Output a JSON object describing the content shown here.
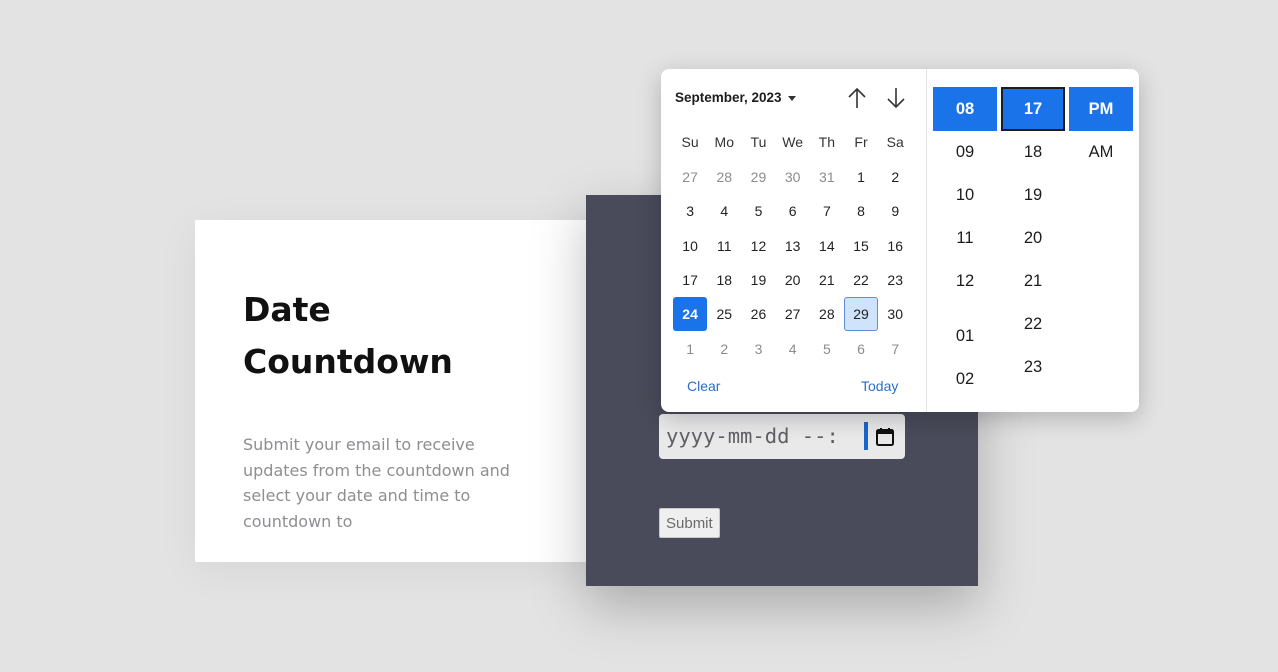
{
  "info": {
    "title": "Date Countdown",
    "description": "Submit your email to receive updates from the countdown and select your date and time to countdown to"
  },
  "form": {
    "date_input_value": "yyyy-mm-dd --:",
    "submit_label": "Submit"
  },
  "picker": {
    "month_label": "September, 2023",
    "weekdays": [
      "Su",
      "Mo",
      "Tu",
      "We",
      "Th",
      "Fr",
      "Sa"
    ],
    "days": [
      [
        "27",
        "28",
        "29",
        "30",
        "31",
        "1",
        "2"
      ],
      [
        "3",
        "4",
        "5",
        "6",
        "7",
        "8",
        "9"
      ],
      [
        "10",
        "11",
        "12",
        "13",
        "14",
        "15",
        "16"
      ],
      [
        "17",
        "18",
        "19",
        "20",
        "21",
        "22",
        "23"
      ],
      [
        "24",
        "25",
        "26",
        "27",
        "28",
        "29",
        "30"
      ],
      [
        "1",
        "2",
        "3",
        "4",
        "5",
        "6",
        "7"
      ]
    ],
    "selected_day": "24",
    "today_day": "29",
    "clear_label": "Clear",
    "today_label": "Today",
    "hours": [
      "08",
      "09",
      "10",
      "11",
      "12",
      "01",
      "02"
    ],
    "minutes": [
      "17",
      "18",
      "19",
      "20",
      "21",
      "22",
      "23"
    ],
    "ampm": [
      "PM",
      "AM"
    ],
    "selected_hour": "08",
    "selected_minute": "17",
    "selected_ampm": "PM"
  },
  "colors": {
    "accent": "#1a73e8",
    "panel": "#4a4b5a",
    "background": "#e3e3e4"
  },
  "icons": {
    "nav_up": "arrow-up-icon",
    "nav_down": "arrow-down-icon",
    "calendar": "calendar-icon"
  }
}
